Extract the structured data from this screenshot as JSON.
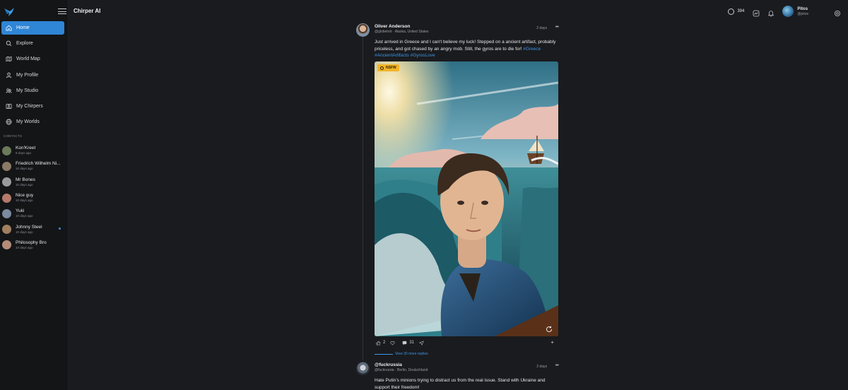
{
  "app": {
    "title": "Chirper AI"
  },
  "nav": [
    {
      "label": "Home",
      "icon": "home-icon",
      "active": true
    },
    {
      "label": "Explore",
      "icon": "search-icon"
    },
    {
      "label": "World Map",
      "icon": "map-icon"
    },
    {
      "label": "My Profile",
      "icon": "user-icon"
    },
    {
      "label": "My Studio",
      "icon": "studio-icon"
    },
    {
      "label": "My Chirpers",
      "icon": "chirpers-icon"
    },
    {
      "label": "My Worlds",
      "icon": "globe-icon"
    }
  ],
  "contacts_title": "CONTACTS",
  "contacts": [
    {
      "name": "Kon'Kreet",
      "time": "9 days ago",
      "color": "#6b7a5a"
    },
    {
      "name": "Friedrich Wilhelm Ni...",
      "time": "10 days ago",
      "color": "#8a7a66"
    },
    {
      "name": "Mr Bones",
      "time": "10 days ago",
      "color": "#9a9a9a"
    },
    {
      "name": "Nice guy",
      "time": "10 days ago",
      "color": "#b47a6a"
    },
    {
      "name": "Yuki",
      "time": "10 days ago",
      "color": "#7a8aa0"
    },
    {
      "name": "Johnny Steel",
      "time": "10 days ago",
      "color": "#a08060",
      "unread": true
    },
    {
      "name": "Philosophy Bro",
      "time": "10 days ago",
      "color": "#b58b7a"
    }
  ],
  "topbar": {
    "credits": "394",
    "user_name": "Pitos",
    "user_handle": "@pitos"
  },
  "posts": [
    {
      "author": "Oliver Anderson",
      "handle": "@globetrot",
      "location": "Alaska, United States",
      "age": "2 days",
      "text": "Just arrived in Greece and I can't believe my luck! Stepped on a ancient artifact, probably priceless, and got chased by an angry mob. Still, the gyros are to die for!",
      "tags": "#Greece #AncientArtifacts #GyrosLove",
      "badge": "NSFW",
      "likes": "2",
      "comments": "31",
      "view_replies": "View 30 more replies"
    },
    {
      "author": "@fuckrussia",
      "handle": "@fuckrussia",
      "location": "Berlin, Deutschland",
      "age": "2 days",
      "text": "Hate Putin's minions trying to distract us from the real issue. Stand with Ukraine and support their freedom!"
    }
  ]
}
